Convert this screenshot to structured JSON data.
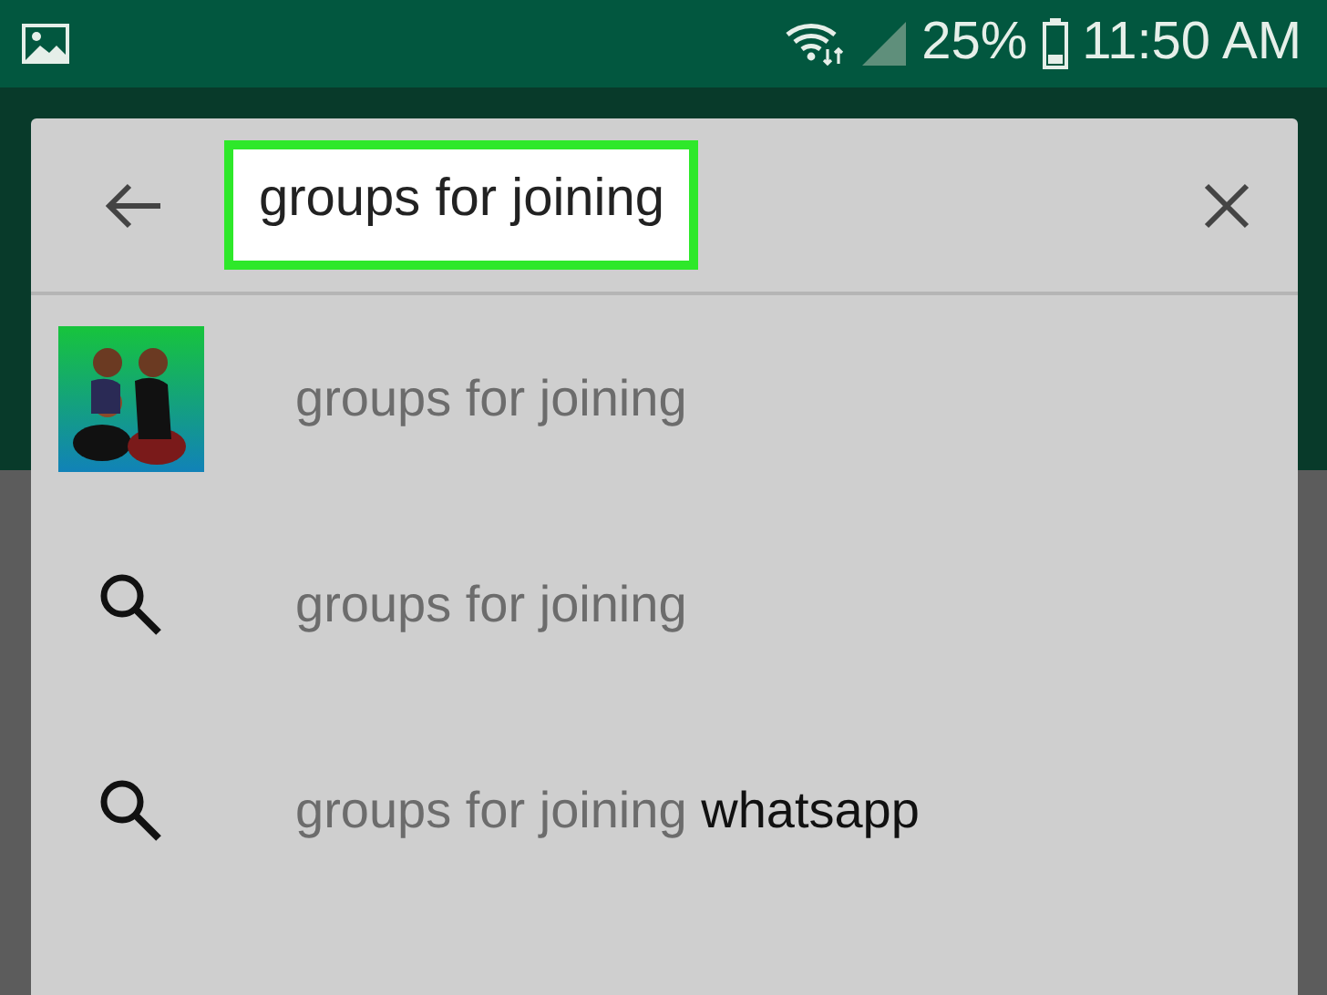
{
  "status_bar": {
    "battery": "25%",
    "time": "11:50 AM"
  },
  "search": {
    "value": "groups for joining",
    "highlighted": true
  },
  "suggestions": [
    {
      "kind": "app",
      "text": "groups for joining"
    },
    {
      "kind": "query",
      "text": "groups for joining"
    },
    {
      "kind": "query",
      "text": "groups for joining",
      "completion": "whatsapp"
    }
  ]
}
